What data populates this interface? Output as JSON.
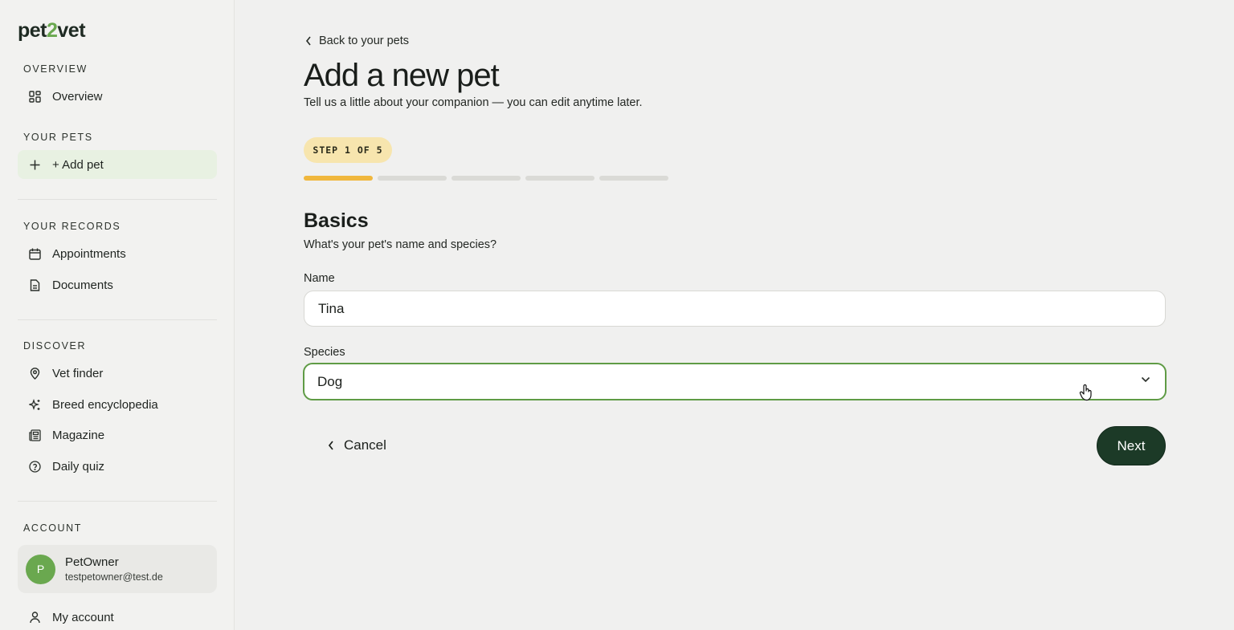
{
  "sidebar": {
    "logo": {
      "prefix": "pet",
      "middle": "2",
      "suffix": "vet"
    },
    "sections": {
      "overview": "OVERVIEW",
      "your_pets": "YOUR PETS",
      "your_records": "YOUR RECORDS",
      "discover": "DISCOVER",
      "account": "ACCOUNT"
    },
    "items": {
      "overview": "Overview",
      "add_pet": "+ Add pet",
      "appointments": "Appointments",
      "documents": "Documents",
      "vet_finder": "Vet finder",
      "breed_encyclopedia": "Breed encyclopedia",
      "magazine": "Magazine",
      "daily_quiz": "Daily quiz",
      "my_account": "My account"
    },
    "account": {
      "avatar_initial": "P",
      "name": "PetOwner",
      "email": "testpetowner@test.de"
    }
  },
  "main": {
    "back_link": "Back to your pets",
    "title": "Add a new pet",
    "subtitle": "Tell us a little about your companion — you can edit anytime later.",
    "step_badge": "STEP 1 OF 5",
    "progress": {
      "current_step": 1,
      "total_steps": 5
    },
    "section_title": "Basics",
    "section_subtitle": "What's your pet's name and species?",
    "name_field": {
      "label": "Name",
      "value": "Tina"
    },
    "species_field": {
      "label": "Species",
      "value": "Dog"
    },
    "cancel_label": "Cancel",
    "next_label": "Next"
  },
  "colors": {
    "accent_green": "#6aa84f",
    "primary_button": "#1c3a27",
    "progress_active": "#f0b73d",
    "step_badge_bg": "#f7e5ae"
  }
}
